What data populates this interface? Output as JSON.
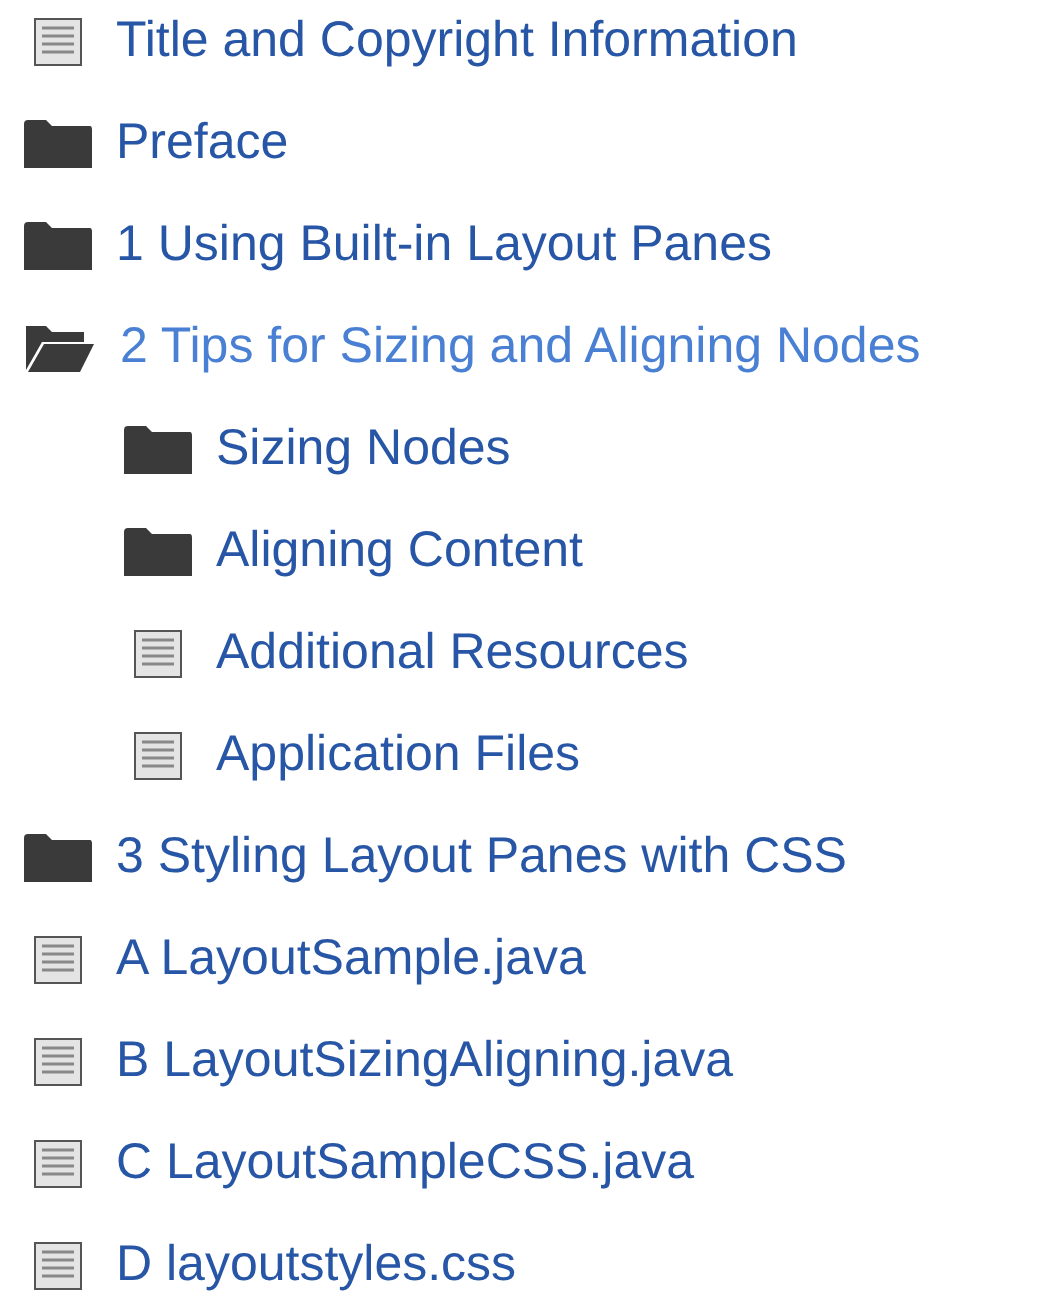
{
  "tree": [
    {
      "kind": "doc",
      "label": "Title and Copyright Information",
      "selected": false
    },
    {
      "kind": "folder",
      "label": "Preface",
      "expanded": false,
      "selected": false
    },
    {
      "kind": "folder",
      "label": "1 Using Built-in Layout Panes",
      "expanded": false,
      "selected": false
    },
    {
      "kind": "folder",
      "label": "2 Tips for Sizing and Aligning Nodes",
      "expanded": true,
      "selected": true,
      "children": [
        {
          "kind": "folder",
          "label": "Sizing Nodes",
          "expanded": false,
          "selected": false
        },
        {
          "kind": "folder",
          "label": "Aligning Content",
          "expanded": false,
          "selected": false
        },
        {
          "kind": "doc",
          "label": "Additional Resources",
          "selected": false
        },
        {
          "kind": "doc",
          "label": "Application Files",
          "selected": false
        }
      ]
    },
    {
      "kind": "folder",
      "label": "3 Styling Layout Panes with CSS",
      "expanded": false,
      "selected": false
    },
    {
      "kind": "doc",
      "label": "A LayoutSample.java",
      "selected": false
    },
    {
      "kind": "doc",
      "label": "B LayoutSizingAligning.java",
      "selected": false
    },
    {
      "kind": "doc",
      "label": "C LayoutSampleCSS.java",
      "selected": false
    },
    {
      "kind": "doc",
      "label": "D layoutstyles.css",
      "selected": false
    }
  ]
}
